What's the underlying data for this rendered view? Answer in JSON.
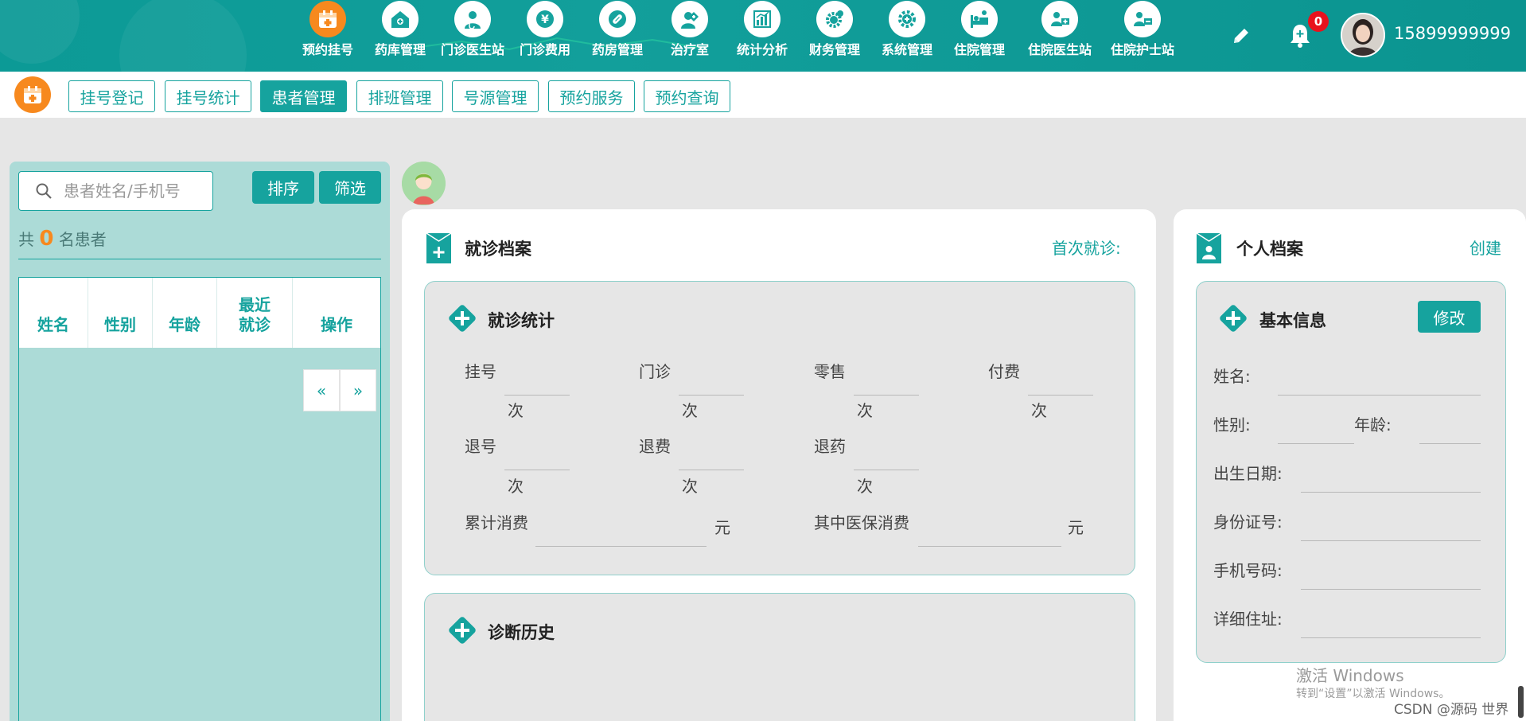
{
  "nav": {
    "items": [
      {
        "label": "预约挂号",
        "icon": "calendar-icon"
      },
      {
        "label": "药库管理",
        "icon": "warehouse-icon"
      },
      {
        "label": "门诊医生站",
        "icon": "doctor-icon"
      },
      {
        "label": "门诊费用",
        "icon": "yen-icon"
      },
      {
        "label": "药房管理",
        "icon": "pill-icon"
      },
      {
        "label": "治疗室",
        "icon": "nurse-icon"
      },
      {
        "label": "统计分析",
        "icon": "chart-icon"
      },
      {
        "label": "财务管理",
        "icon": "finance-gear-icon"
      },
      {
        "label": "系统管理",
        "icon": "gear-icon"
      },
      {
        "label": "住院管理",
        "icon": "bed-icon"
      },
      {
        "label": "住院医生站",
        "icon": "inpatient-doctor-icon"
      },
      {
        "label": "住院护士站",
        "icon": "inpatient-nurse-icon"
      }
    ],
    "notification_count": "0",
    "username": "15899999999"
  },
  "subtabs": [
    "挂号登记",
    "挂号统计",
    "患者管理",
    "排班管理",
    "号源管理",
    "预约服务",
    "预约查询"
  ],
  "left": {
    "search_placeholder": "患者姓名/手机号",
    "sort_label": "排序",
    "filter_label": "筛选",
    "count_prefix": "共",
    "count": "0",
    "count_suffix": "名患者",
    "columns": [
      "姓名",
      "性别",
      "年龄",
      "最近就诊",
      "操作"
    ],
    "prev": "«",
    "next": "»"
  },
  "visit": {
    "title": "就诊档案",
    "first_visit_label": "首次就诊:",
    "stats_title": "就诊统计",
    "row1": [
      "挂号",
      "门诊",
      "零售",
      "付费"
    ],
    "row2": [
      "退号",
      "退费",
      "退药"
    ],
    "unit_times": "次",
    "total_label": "累计消费",
    "insurance_label": "其中医保消费",
    "unit_yuan": "元",
    "history_title": "诊断历史"
  },
  "profile": {
    "title": "个人档案",
    "create_label": "创建",
    "basic_title": "基本信息",
    "edit_label": "修改",
    "name_label": "姓名:",
    "gender_label": "性别:",
    "age_label": "年龄:",
    "birth_label": "出生日期:",
    "id_label": "身份证号:",
    "phone_label": "手机号码:",
    "address_label": "详细住址:"
  },
  "watermark": {
    "line1": "激活 Windows",
    "line2": "转到“设置”以激活 Windows。",
    "csdn": "CSDN @源码 世界"
  },
  "colors": {
    "teal": "#16a39e",
    "orange": "#f7891e",
    "nav_bg": "#0c9a96",
    "panel": "#acdbd7"
  }
}
